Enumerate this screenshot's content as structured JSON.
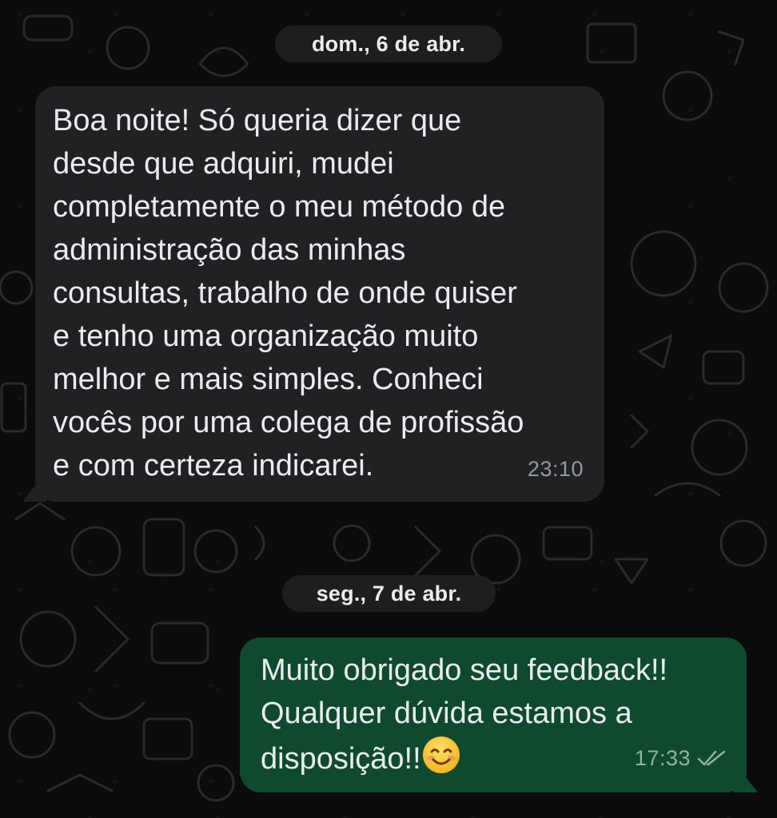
{
  "chat": {
    "dates": [
      {
        "label": "dom., 6 de abr."
      },
      {
        "label": "seg., 7 de abr."
      }
    ],
    "messages": [
      {
        "direction": "incoming",
        "text": "Boa noite! Só queria dizer que\ndesde que adquiri, mudei\ncompletamente o meu método de\nadministração das minhas\nconsultas, trabalho de onde quiser\ne tenho uma organização muito\nmelhor e mais simples. Conheci\nvocês por uma colega de profissão\ne com certeza indicarei.",
        "time": "23:10"
      },
      {
        "direction": "outgoing",
        "text": "Muito obrigado seu feedback!!\nQualquer dúvida estamos a\ndisposição!!",
        "emoji": "smiling-face-emoji",
        "time": "17:33",
        "status_icon": "double-check-icon"
      }
    ]
  },
  "colors": {
    "background": "#0b0b0b",
    "incoming_bubble": "#202122",
    "outgoing_bubble": "#0f4a2e",
    "date_pill": "#1d1f1f",
    "text": "#e9edef",
    "timestamp": "#8f9a9e"
  }
}
